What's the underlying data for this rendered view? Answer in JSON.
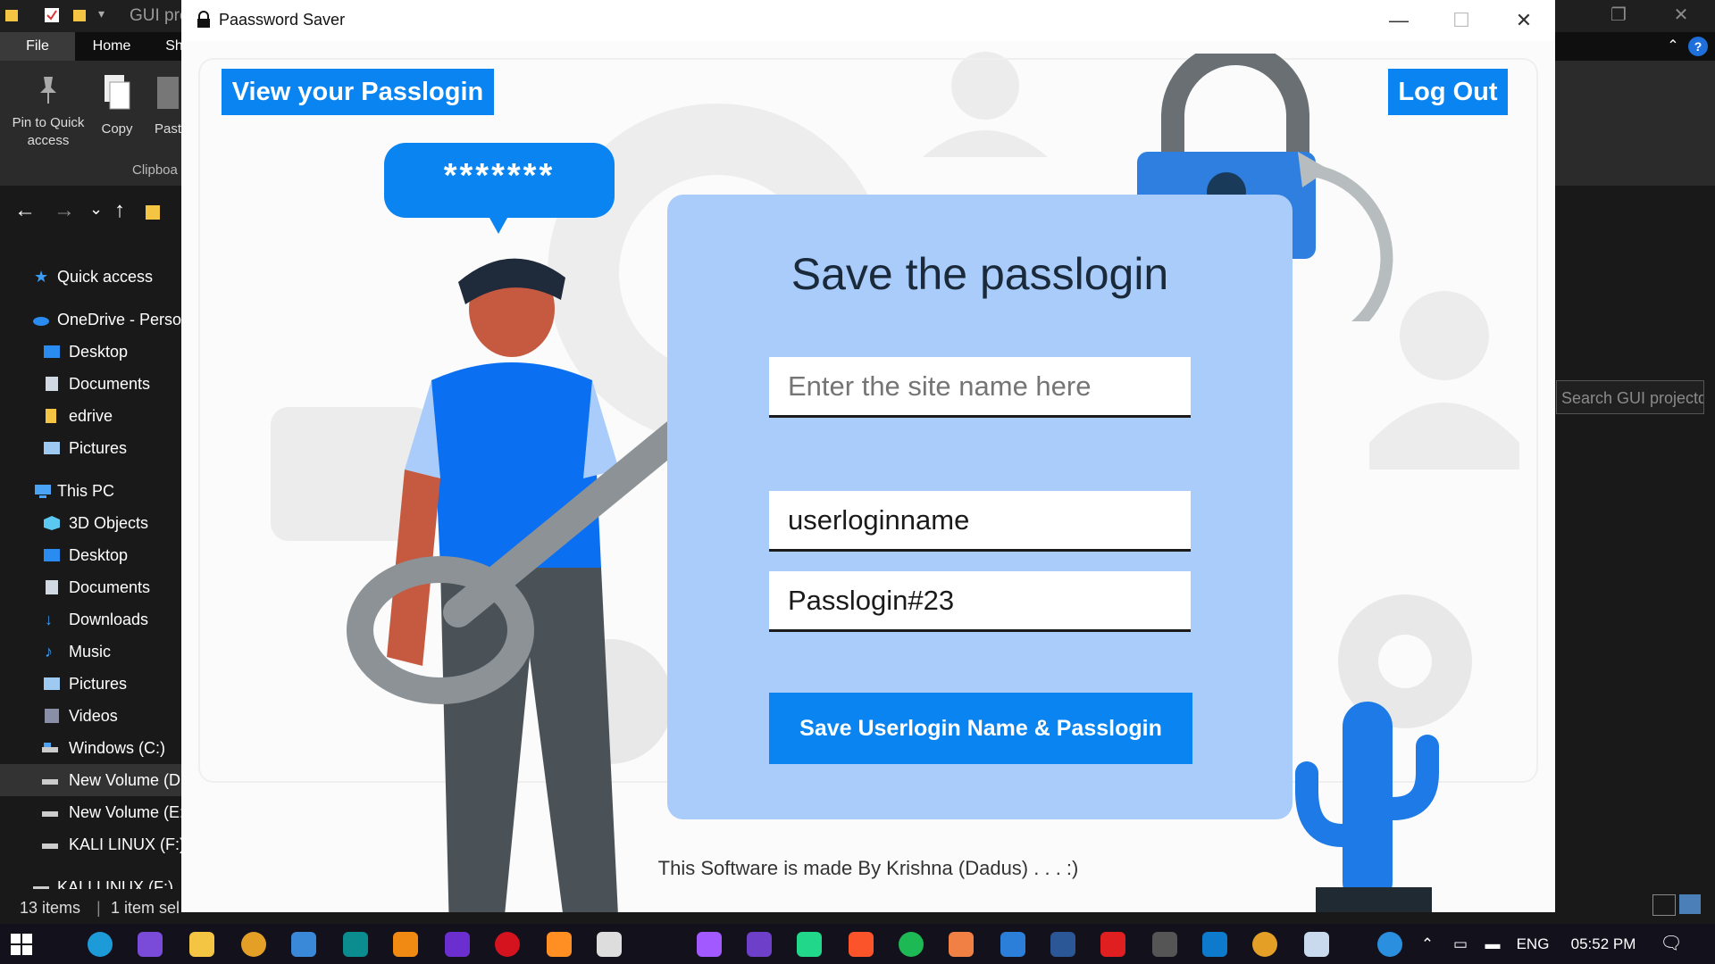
{
  "explorer": {
    "title": "GUI projects",
    "tabs": [
      "File",
      "Home",
      "Sh"
    ],
    "ribbon": {
      "pin": "Pin to Quick access",
      "copy": "Copy",
      "paste": "Past",
      "group": "Clipboa"
    },
    "search_placeholder": "Search GUI projectd",
    "nav": [
      {
        "label": "Quick access",
        "icon": "star-icon"
      },
      {
        "label": "OneDrive - Personal",
        "icon": "cloud-icon"
      },
      {
        "label": "Desktop",
        "icon": "desktop-folder-icon"
      },
      {
        "label": "Documents",
        "icon": "documents-folder-icon"
      },
      {
        "label": "edrive",
        "icon": "folder-icon"
      },
      {
        "label": "Pictures",
        "icon": "pictures-folder-icon"
      },
      {
        "label": "This PC",
        "icon": "computer-icon"
      },
      {
        "label": "3D Objects",
        "icon": "cube-icon"
      },
      {
        "label": "Desktop",
        "icon": "desktop-folder-icon"
      },
      {
        "label": "Documents",
        "icon": "documents-folder-icon"
      },
      {
        "label": "Downloads",
        "icon": "download-arrow-icon"
      },
      {
        "label": "Music",
        "icon": "music-note-icon"
      },
      {
        "label": "Pictures",
        "icon": "pictures-folder-icon"
      },
      {
        "label": "Videos",
        "icon": "film-icon"
      },
      {
        "label": "Windows (C:)",
        "icon": "drive-icon"
      },
      {
        "label": "New Volume (D:)",
        "icon": "drive-icon"
      },
      {
        "label": "New Volume (E:)",
        "icon": "drive-icon"
      },
      {
        "label": "KALI LINUX (F:)",
        "icon": "drive-icon"
      },
      {
        "label": "KALI LINUX (F:)",
        "icon": "drive-icon"
      }
    ],
    "status": {
      "items": "13 items",
      "selected": "1 item sel"
    }
  },
  "app": {
    "title": "Paassword Saver",
    "view_button": "View your Passlogin",
    "logout_button": "Log Out",
    "speech_bubble": "*******",
    "card_title": "Save the passlogin",
    "site_placeholder": "Enter the site name here",
    "username_value": "userloginname",
    "password_value": "Passlogin#23",
    "save_button": "Save Userlogin Name & Passlogin",
    "footer": "This Software is made By Krishna (Dadus) . . . :)",
    "colors": {
      "accent": "#0a84f0",
      "card": "#a9ccfb",
      "lock": "#2e7fe0"
    }
  },
  "taskbar": {
    "language": "ENG",
    "time": "05:52 PM",
    "apps": [
      "windows-start-icon",
      "edge-icon",
      "messenger-icon",
      "file-explorer-icon",
      "chrome-icon",
      "remote-desktop-icon",
      "arduino-icon",
      "vlc-icon",
      "intellij-icon",
      "opera-icon",
      "sublime-icon",
      "unity-icon",
      "figma-icon",
      "github-desktop-icon",
      "pycharm-icon",
      "brave-icon",
      "spotify-icon",
      "scribble-icon",
      "photos-icon",
      "word-icon",
      "acrobat-icon",
      "settings-icon",
      "vscode-icon",
      "chrome-icon",
      "notepad-icon"
    ]
  }
}
